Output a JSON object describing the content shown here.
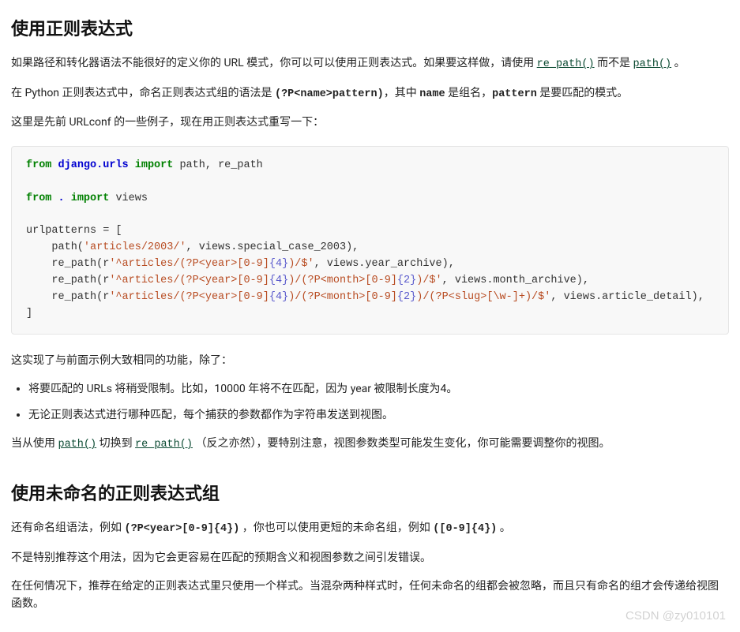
{
  "s1": {
    "heading": "使用正则表达式",
    "p1_a": "如果路径和转化器语法不能很好的定义你的 URL 模式，你可以可以使用正则表达式。如果要这样做，请使用 ",
    "p1_link1": "re_path()",
    "p1_b": " 而不是 ",
    "p1_link2": "path()",
    "p1_c": " 。",
    "p2_a": "在 Python 正则表达式中，命名正则表达式组的语法是 ",
    "p2_syntax": "(?P<name>pattern)",
    "p2_b": "，其中 ",
    "p2_name": "name",
    "p2_c": " 是组名，",
    "p2_pattern": "pattern",
    "p2_d": " 是要匹配的模式。",
    "p3": "这里是先前 URLconf 的一些例子，现在用正则表达式重写一下："
  },
  "code": {
    "l1_kw1": "from",
    "l1_nm": "django.urls",
    "l1_kw2": "import",
    "l1_rest": " path, re_path",
    "l3_kw1": "from",
    "l3_nm": ".",
    "l3_kw2": "import",
    "l3_rest": " views",
    "l5": "urlpatterns = [",
    "l6_a": "    path(",
    "l6_s": "'articles/2003/'",
    "l6_b": ", views.special_case_2003),",
    "l7_a": "    re_path(r",
    "l7_s1": "'^articles/(?P<year>[0-9]",
    "l7_n1": "{4}",
    "l7_s2": ")/$'",
    "l7_b": ", views.year_archive),",
    "l8_a": "    re_path(r",
    "l8_s1": "'^articles/(?P<year>[0-9]",
    "l8_n1": "{4}",
    "l8_s2": ")/(?P<month>[0-9]",
    "l8_n2": "{2}",
    "l8_s3": ")/$'",
    "l8_b": ", views.month_archive),",
    "l9_a": "    re_path(r",
    "l9_s1": "'^articles/(?P<year>[0-9]",
    "l9_n1": "{4}",
    "l9_s2": ")/(?P<month>[0-9]",
    "l9_n2": "{2}",
    "l9_s3": ")/(?P<slug>[\\w-]+)/$'",
    "l9_b": ", views.article_detail),",
    "l10": "]"
  },
  "s2": {
    "p1": "这实现了与前面示例大致相同的功能，除了：",
    "li1": "将要匹配的 URLs 将稍受限制。比如，10000 年将不在匹配，因为 year 被限制长度为4。",
    "li2": "无论正则表达式进行哪种匹配，每个捕获的参数都作为字符串发送到视图。",
    "p2_a": "当从使用 ",
    "p2_link1": "path()",
    "p2_b": " 切换到 ",
    "p2_link2": "re_path()",
    "p2_c": " （反之亦然），要特别注意，视图参数类型可能发生变化，你可能需要调整你的视图。"
  },
  "s3": {
    "heading": "使用未命名的正则表达式组",
    "p1_a": "还有命名组语法，例如 ",
    "p1_code1": "(?P<year>[0-9]{4})",
    "p1_b": " ，你也可以使用更短的未命名组，例如 ",
    "p1_code2": "([0-9]{4})",
    "p1_c": " 。",
    "p2": "不是特别推荐这个用法，因为它会更容易在匹配的预期含义和视图参数之间引发错误。",
    "p3": "在任何情况下，推荐在给定的正则表达式里只使用一个样式。当混杂两种样式时，任何未命名的组都会被忽略，而且只有命名的组才会传递给视图函数。"
  },
  "watermark": "CSDN @zy010101"
}
